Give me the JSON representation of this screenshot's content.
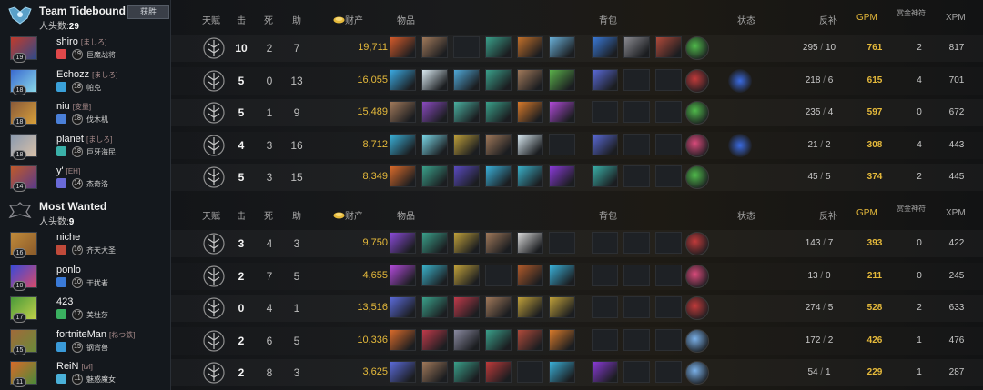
{
  "colors": {
    "gold": "#e5b93b",
    "panel": "#14181d",
    "bg": "#0d0f12"
  },
  "header_labels": {
    "talent": "天赋",
    "kills": "击",
    "deaths": "死",
    "assists": "助",
    "net_worth": "财产",
    "items": "物品",
    "backpack": "背包",
    "status": "状态",
    "lh_dn": "反补",
    "gpm": "GPM",
    "bounty_runes": "赏金神符",
    "xpm": "XPM"
  },
  "teams": [
    {
      "name": "Team Tidebound",
      "count_label": "人头数:",
      "count": "29",
      "badge": "获胜",
      "players": [
        {
          "name": "shiro",
          "tag": "[ましろ]",
          "level": "19",
          "rank_color": "#e0484a",
          "hero": "巨魔战将",
          "portrait": [
            "#c23b2b",
            "#2e4a8a"
          ],
          "kills": "10",
          "deaths": "2",
          "assists": "7",
          "net_worth": "19,711",
          "last_hits": "295",
          "denies": "10",
          "gpm": "761",
          "runes": "2",
          "xpm": "817",
          "items": [
            "#d35a2a",
            "#a0795a",
            "",
            "#3aa08a",
            "#c2702a",
            "#6ab0d8"
          ],
          "backpack": [
            "#3a7ad8",
            "#8a8a90",
            "#b04a3a"
          ],
          "neutral": "#4fb84a",
          "buff": ""
        },
        {
          "name": "Echozz",
          "tag": "[ましろ]",
          "level": "18",
          "rank_color": "#3aa0d8",
          "hero": "帕克",
          "portrait": [
            "#3a6ad0",
            "#8ad8e8"
          ],
          "kills": "5",
          "deaths": "0",
          "assists": "13",
          "net_worth": "16,055",
          "last_hits": "218",
          "denies": "6",
          "gpm": "615",
          "runes": "4",
          "xpm": "701",
          "items": [
            "#3aa8e0",
            "#d8e8f0",
            "#4fa8d8",
            "#3aa08a",
            "#a0795a",
            "#5ab04a"
          ],
          "backpack": [
            "#5a6ad8",
            "",
            ""
          ],
          "neutral": "#c03a3a",
          "buff": "#3a6ae0"
        },
        {
          "name": "niu",
          "tag": "[变量]",
          "level": "18",
          "rank_color": "#4a7fd8",
          "hero": "伐木机",
          "portrait": [
            "#8a5a3a",
            "#d8a03a"
          ],
          "kills": "5",
          "deaths": "1",
          "assists": "9",
          "net_worth": "15,489",
          "last_hits": "235",
          "denies": "4",
          "gpm": "597",
          "runes": "0",
          "xpm": "672",
          "items": [
            "#a0795a",
            "#8a4ac0",
            "#4ab0a0",
            "#3aa08a",
            "#d87a2a",
            "#b04ad8"
          ],
          "backpack": [
            "",
            "",
            ""
          ],
          "neutral": "#4fb84a",
          "buff": ""
        },
        {
          "name": "planet",
          "tag": "[ましろ]",
          "level": "18",
          "rank_color": "#3ab0a8",
          "hero": "巨牙海民",
          "portrait": [
            "#8a9ab0",
            "#d8c0a8"
          ],
          "kills": "4",
          "deaths": "3",
          "assists": "16",
          "net_worth": "8,712",
          "last_hits": "21",
          "denies": "2",
          "gpm": "308",
          "runes": "4",
          "xpm": "443",
          "items": [
            "#3ab0d8",
            "#7ad8e8",
            "#c0a03a",
            "#a0795a",
            "#d8e8f0",
            ""
          ],
          "backpack": [
            "#5a6ad8",
            "",
            ""
          ],
          "neutral": "#d84a7a",
          "buff": "#3a6ae0"
        },
        {
          "name": "y'",
          "tag": "[EH]",
          "level": "14",
          "rank_color": "#6a6ad8",
          "hero": "杰奇洛",
          "portrait": [
            "#c05a2a",
            "#5a3a8a"
          ],
          "kills": "5",
          "deaths": "3",
          "assists": "15",
          "net_worth": "8,349",
          "last_hits": "45",
          "denies": "5",
          "gpm": "374",
          "runes": "2",
          "xpm": "445",
          "items": [
            "#d86a2a",
            "#3aa08a",
            "#5a4ac0",
            "#3ab0d8",
            "#3ab0c8",
            "#8a3ad8"
          ],
          "backpack": [
            "#3ab0a8",
            "",
            ""
          ],
          "neutral": "#4fb84a",
          "buff": ""
        }
      ]
    },
    {
      "name": "Most Wanted",
      "count_label": "人头数:",
      "count": "9",
      "badge": "",
      "players": [
        {
          "name": "niche",
          "tag": "",
          "level": "16",
          "rank_color": "#c04a3a",
          "hero": "齐天大圣",
          "portrait": [
            "#c08a3a",
            "#8a5a2a"
          ],
          "kills": "3",
          "deaths": "4",
          "assists": "3",
          "net_worth": "9,750",
          "last_hits": "143",
          "denies": "7",
          "gpm": "393",
          "runes": "0",
          "xpm": "422",
          "items": [
            "#8a4ad8",
            "#3aa08a",
            "#c0a03a",
            "#a0795a",
            "#d8d8d8",
            ""
          ],
          "backpack": [
            "",
            "",
            ""
          ],
          "neutral": "#c03a3a",
          "buff": ""
        },
        {
          "name": "ponlo",
          "tag": "",
          "level": "10",
          "rank_color": "#3a7ad8",
          "hero": "干扰者",
          "portrait": [
            "#3a4ad8",
            "#d84a6a"
          ],
          "kills": "2",
          "deaths": "7",
          "assists": "5",
          "net_worth": "4,655",
          "last_hits": "13",
          "denies": "0",
          "gpm": "211",
          "runes": "0",
          "xpm": "245",
          "items": [
            "#b04ad8",
            "#3ab0c8",
            "#c0a03a",
            "",
            "#b05a2a",
            "#3ab0d8"
          ],
          "backpack": [
            "",
            "",
            ""
          ],
          "neutral": "#d84a7a",
          "buff": ""
        },
        {
          "name": "423",
          "tag": "",
          "level": "17",
          "rank_color": "#3ab060",
          "hero": "美杜莎",
          "portrait": [
            "#4a9a3a",
            "#c0d04a"
          ],
          "kills": "0",
          "deaths": "4",
          "assists": "1",
          "net_worth": "13,516",
          "last_hits": "274",
          "denies": "5",
          "gpm": "528",
          "runes": "2",
          "xpm": "633",
          "items": [
            "#5a6ad8",
            "#3aa08a",
            "#c03a4a",
            "#a0795a",
            "#c0a03a",
            "#c0a03a"
          ],
          "backpack": [
            "",
            "",
            ""
          ],
          "neutral": "#c03a3a",
          "buff": ""
        },
        {
          "name": "fortniteMan",
          "tag": "[ねつ鉄]",
          "level": "15",
          "rank_color": "#3a9ad8",
          "hero": "钢背兽",
          "portrait": [
            "#a06a3a",
            "#6a8a3a"
          ],
          "kills": "2",
          "deaths": "6",
          "assists": "5",
          "net_worth": "10,336",
          "last_hits": "172",
          "denies": "2",
          "gpm": "426",
          "runes": "1",
          "xpm": "476",
          "items": [
            "#d86a2a",
            "#c03a4a",
            "#8a8aa0",
            "#3aa08a",
            "#b04a3a",
            "#d87a2a"
          ],
          "backpack": [
            "",
            "",
            ""
          ],
          "neutral": "#7ab0e8",
          "buff": ""
        },
        {
          "name": "ReiN",
          "tag": "[tvl]",
          "level": "11",
          "rank_color": "#4ab0d8",
          "hero": "魅惑魔女",
          "portrait": [
            "#d86a2a",
            "#4a8a3a"
          ],
          "kills": "2",
          "deaths": "8",
          "assists": "3",
          "net_worth": "3,625",
          "last_hits": "54",
          "denies": "1",
          "gpm": "229",
          "runes": "1",
          "xpm": "287",
          "items": [
            "#5a6ad8",
            "#a0795a",
            "#3aa08a",
            "#c03a3a",
            "",
            "#3ab0d8"
          ],
          "backpack": [
            "#8a3ad8",
            "",
            ""
          ],
          "neutral": "#7ab0e8",
          "buff": ""
        }
      ]
    }
  ]
}
